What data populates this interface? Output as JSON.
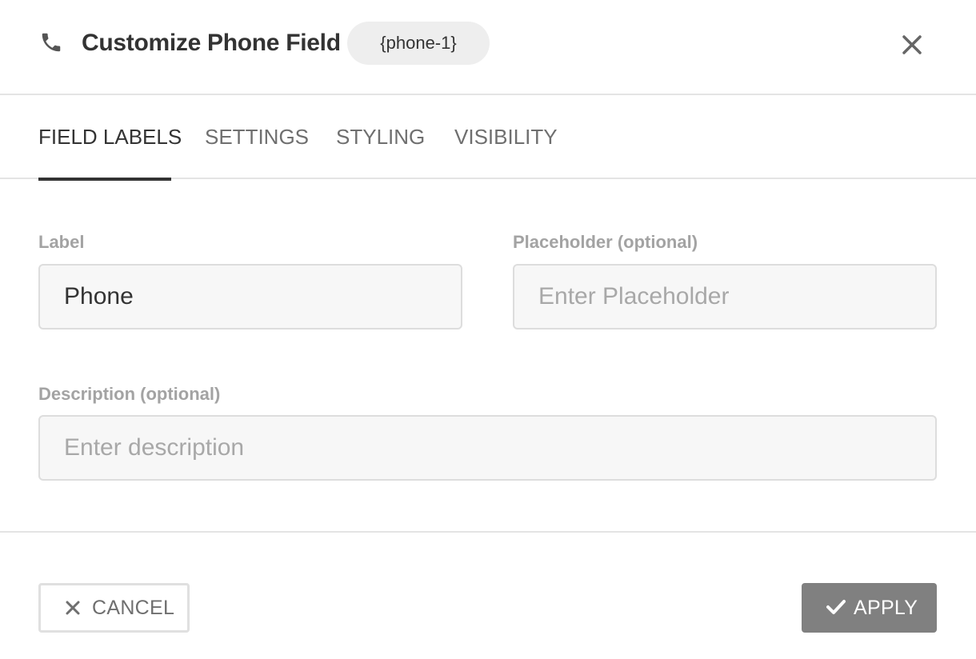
{
  "header": {
    "icon": "phone-icon",
    "title": "Customize Phone Field",
    "tag": "{phone-1}",
    "close_icon": "close-icon"
  },
  "tabs": [
    {
      "label": "FIELD LABELS",
      "active": true
    },
    {
      "label": "SETTINGS",
      "active": false
    },
    {
      "label": "STYLING",
      "active": false
    },
    {
      "label": "VISIBILITY",
      "active": false
    }
  ],
  "form": {
    "label_field": {
      "label": "Label",
      "value": "Phone",
      "placeholder": ""
    },
    "placeholder_field": {
      "label": "Placeholder (optional)",
      "value": "",
      "placeholder": "Enter Placeholder"
    },
    "description_field": {
      "label": "Description (optional)",
      "value": "",
      "placeholder": "Enter description"
    }
  },
  "footer": {
    "cancel_label": "CANCEL",
    "cancel_icon": "x-icon",
    "apply_label": "APPLY",
    "apply_icon": "check-icon"
  },
  "colors": {
    "primary_text": "#333333",
    "muted_text": "#6f6f6f",
    "label_text": "#a3a3a3",
    "apply_button_bg": "#808080",
    "tag_bg": "#eeeeee",
    "input_bg": "#f7f7f7"
  }
}
